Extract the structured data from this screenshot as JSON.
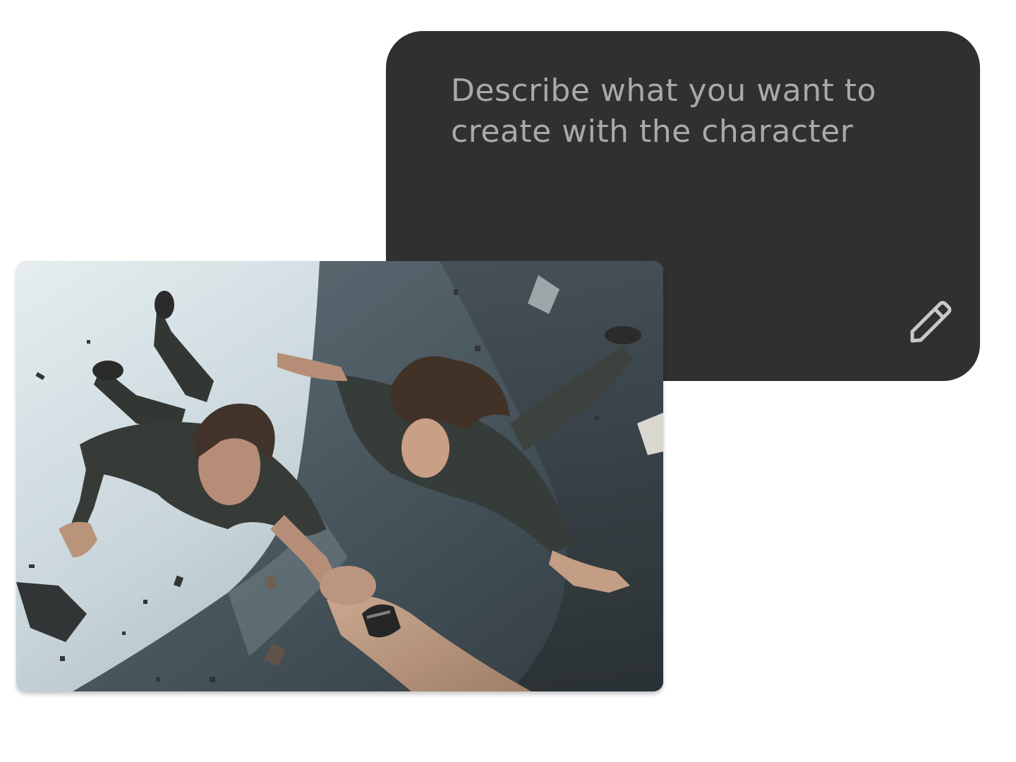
{
  "prompt": {
    "placeholder": "Describe what you want to create with the character",
    "card_color": "#303030",
    "text_color": "#a9a9a9"
  },
  "edit": {
    "icon": "pencil-icon"
  },
  "image": {
    "icon": "photo",
    "alt": ""
  }
}
